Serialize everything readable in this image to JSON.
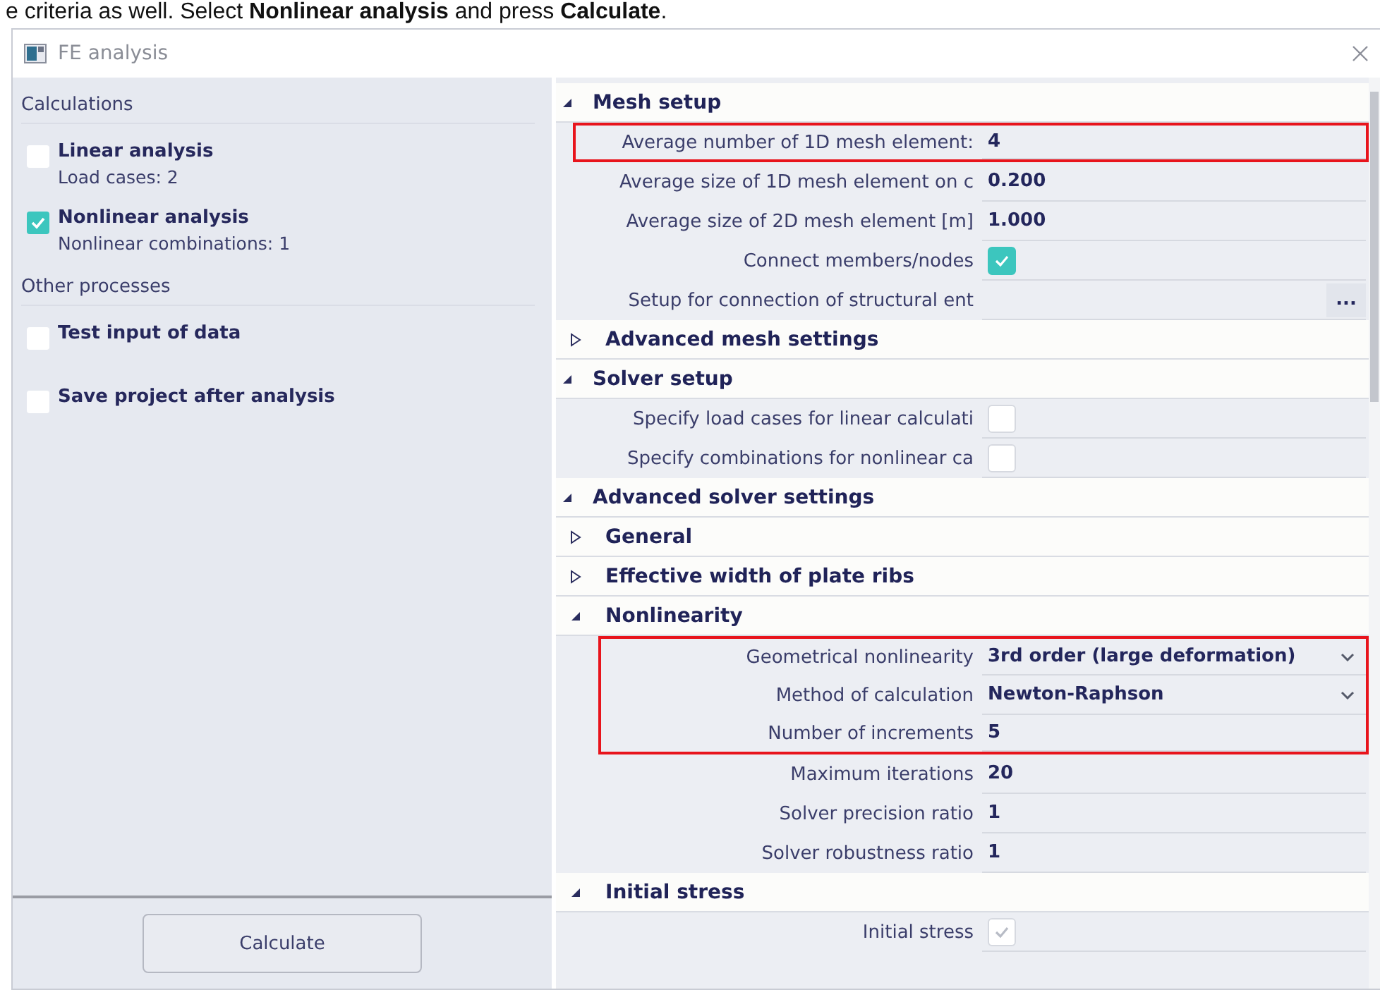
{
  "caption": "e criteria as well. Select **Nonlinear analysis** and press **Calculate**.",
  "window": {
    "title": "FE analysis"
  },
  "left_panel": {
    "groups": [
      {
        "heading": "Calculations",
        "items": [
          {
            "label": "Linear analysis",
            "detail": "Load cases: 2",
            "checked": false
          },
          {
            "label": "Nonlinear analysis",
            "detail": "Nonlinear combinations: 1",
            "checked": true
          }
        ]
      },
      {
        "heading": "Other processes",
        "items": [
          {
            "label": "Test input of data",
            "checked": false
          },
          {
            "label": "Save project after analysis",
            "checked": false
          }
        ]
      }
    ],
    "button": "Calculate"
  },
  "properties": [
    {
      "kind": "section",
      "label": "Mesh setup",
      "expanded": true,
      "children": [
        {
          "kind": "text",
          "label": "Average number of 1D mesh element:",
          "value": "4",
          "highlighted": true
        },
        {
          "kind": "text",
          "label": "Average size of 1D mesh element on c",
          "value": "0.200",
          "highlighted": false
        },
        {
          "kind": "text",
          "label": "Average size of 2D mesh element [m]",
          "value": "1.000",
          "highlighted": false
        },
        {
          "kind": "checkbox",
          "label": "Connect members/nodes",
          "checked": true,
          "disabled": false,
          "highlighted": false
        },
        {
          "kind": "button",
          "label": "Setup for connection of structural ent",
          "button": "...",
          "highlighted": false
        },
        {
          "kind": "section",
          "label": "Advanced mesh settings",
          "expanded": false
        }
      ]
    },
    {
      "kind": "section",
      "label": "Solver setup",
      "expanded": true,
      "children": [
        {
          "kind": "checkbox",
          "label": "Specify load cases for linear calculati",
          "checked": false,
          "disabled": false,
          "highlighted": false
        },
        {
          "kind": "checkbox",
          "label": "Specify combinations for nonlinear ca",
          "checked": false,
          "disabled": false,
          "highlighted": false
        }
      ]
    },
    {
      "kind": "section",
      "label": "Advanced solver settings",
      "expanded": true,
      "children": [
        {
          "kind": "section",
          "label": "General",
          "expanded": false
        },
        {
          "kind": "section",
          "label": "Effective width of plate ribs",
          "expanded": false
        },
        {
          "kind": "section",
          "label": "Nonlinearity",
          "expanded": true,
          "children": [
            {
              "kind": "dropdown",
              "label": "Geometrical nonlinearity",
              "value": "3rd order (large deformation)",
              "highlighted": true
            },
            {
              "kind": "dropdown",
              "label": "Method of calculation",
              "value": "Newton-Raphson",
              "highlighted": true
            },
            {
              "kind": "text",
              "label": "Number of increments",
              "value": "5",
              "highlighted": true
            },
            {
              "kind": "text",
              "label": "Maximum iterations",
              "value": "20",
              "highlighted": false
            },
            {
              "kind": "text",
              "label": "Solver precision ratio",
              "value": "1",
              "highlighted": false
            },
            {
              "kind": "text",
              "label": "Solver robustness ratio",
              "value": "1",
              "highlighted": false
            }
          ]
        },
        {
          "kind": "section",
          "label": "Initial stress",
          "expanded": true,
          "children": [
            {
              "kind": "checkbox",
              "label": "Initial stress",
              "checked": true,
              "disabled": true,
              "highlighted": false
            }
          ]
        }
      ]
    }
  ]
}
